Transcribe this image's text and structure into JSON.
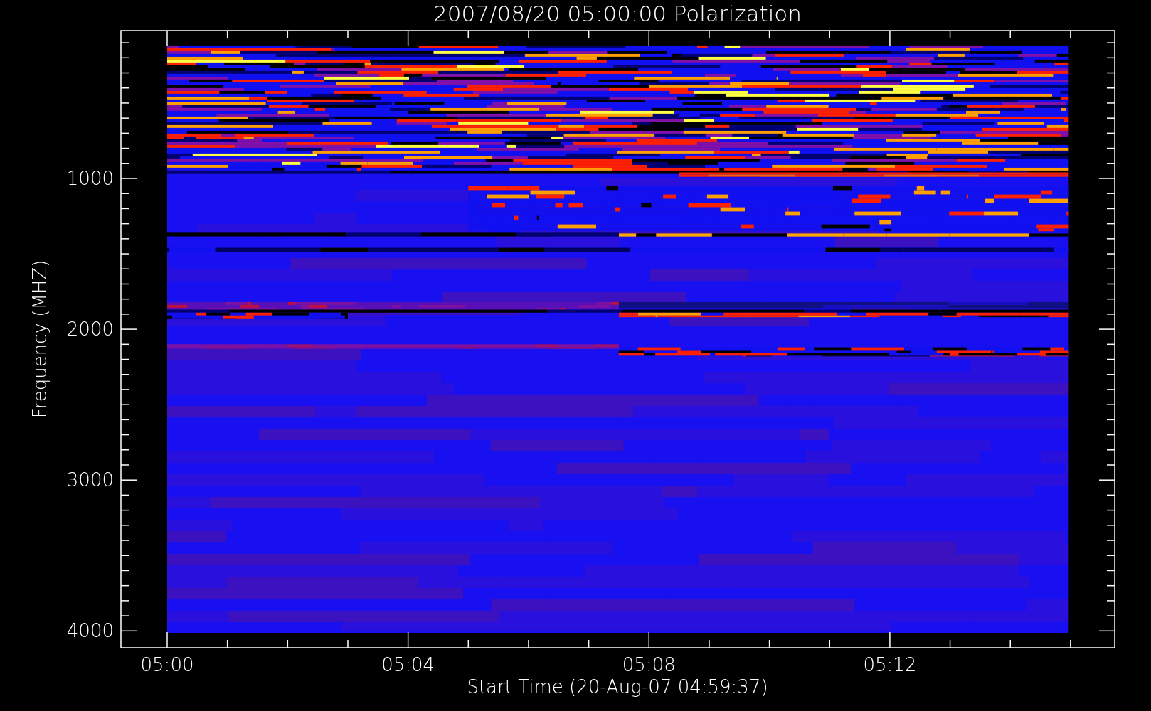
{
  "plot": {
    "title": "2007/08/20 05:00:00 Polarization",
    "ylabel": "Frequency (MHZ)",
    "xlabel": "Start Time (20-Aug-07 04:59:37)",
    "yticks": [
      "1000",
      "2000",
      "3000",
      "4000"
    ],
    "xticks": [
      "05:00",
      "05:04",
      "05:08",
      "05:12"
    ]
  }
}
